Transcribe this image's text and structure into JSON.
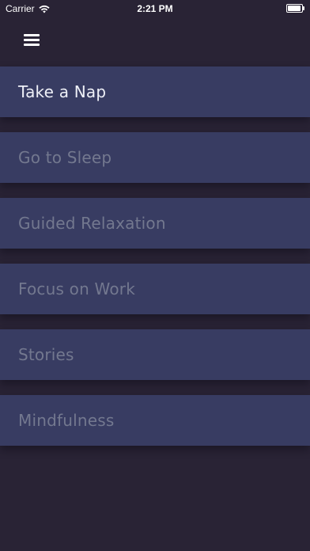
{
  "status_bar": {
    "carrier": "Carrier",
    "time": "2:21 PM",
    "wifi_icon": "wifi-icon",
    "battery_icon": "battery-icon"
  },
  "header": {
    "menu_icon": "hamburger-menu-icon"
  },
  "menu": {
    "items": [
      {
        "label": "Take a Nap",
        "active": true
      },
      {
        "label": "Go to Sleep",
        "active": false
      },
      {
        "label": "Guided Relaxation",
        "active": false
      },
      {
        "label": "Focus on Work",
        "active": false
      },
      {
        "label": "Stories",
        "active": false
      },
      {
        "label": "Mindfulness",
        "active": false
      }
    ]
  },
  "colors": {
    "background": "#292335",
    "item_background": "#383c62",
    "active_text": "#eef0f7",
    "inactive_text": "#73788f"
  }
}
